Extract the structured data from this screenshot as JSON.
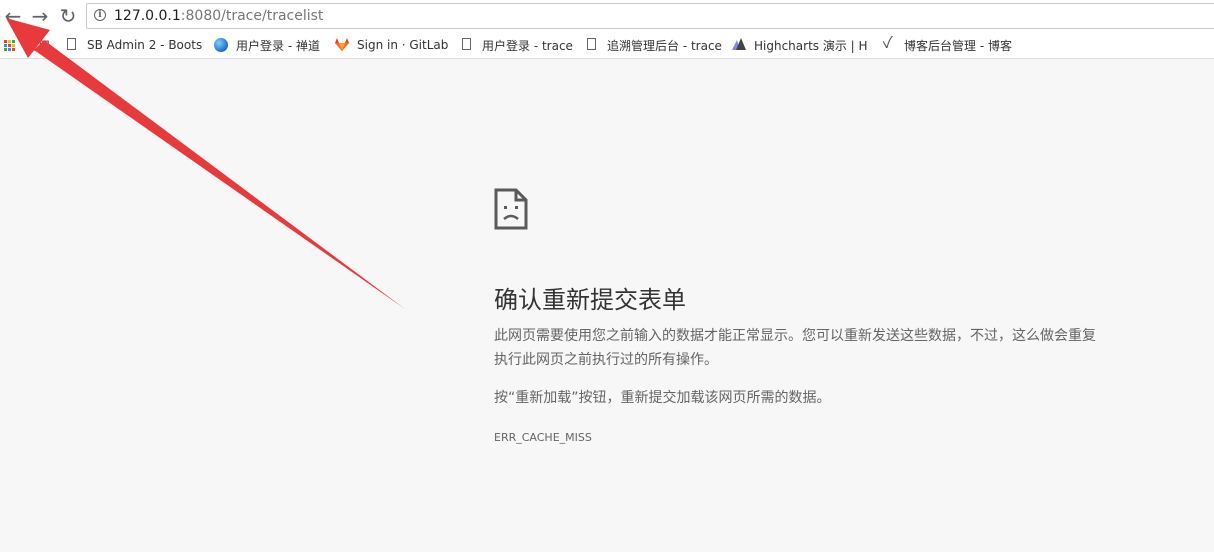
{
  "toolbar": {
    "url_host": "127.0.0.1",
    "url_rest": ":8080/trace/tracelist",
    "back_glyph": "←",
    "forward_glyph": "→",
    "reload_glyph": "↻",
    "info_glyph": "i"
  },
  "bookmarks": [
    {
      "label": "应用",
      "icon": "apps-icon"
    },
    {
      "label": "SB Admin 2 - Boots",
      "icon": "page-icon"
    },
    {
      "label": "用户登录 - 禅道",
      "icon": "globe-icon"
    },
    {
      "label": "Sign in · GitLab",
      "icon": "gitlab-icon"
    },
    {
      "label": "用户登录 - trace",
      "icon": "page-icon"
    },
    {
      "label": "追溯管理后台 - trace",
      "icon": "page-icon"
    },
    {
      "label": "Highcharts 演示 | Hi",
      "icon": "highcharts-icon"
    },
    {
      "label": "博客后台管理 - 博客",
      "icon": "blog-icon"
    }
  ],
  "error": {
    "title": "确认重新提交表单",
    "description": "此网页需要使用您之前输入的数据才能正常显示。您可以重新发送这些数据，不过，这么做会重复执行此网页之前执行过的所有操作。",
    "hint": "按“重新加载”按钮，重新提交加载该网页所需的数据。",
    "code": "ERR_CACHE_MISS"
  },
  "colors": {
    "page_background": "#f7f7f7",
    "annotation_arrow": "#e8393c",
    "text_primary": "#333333",
    "text_secondary": "#646464"
  }
}
